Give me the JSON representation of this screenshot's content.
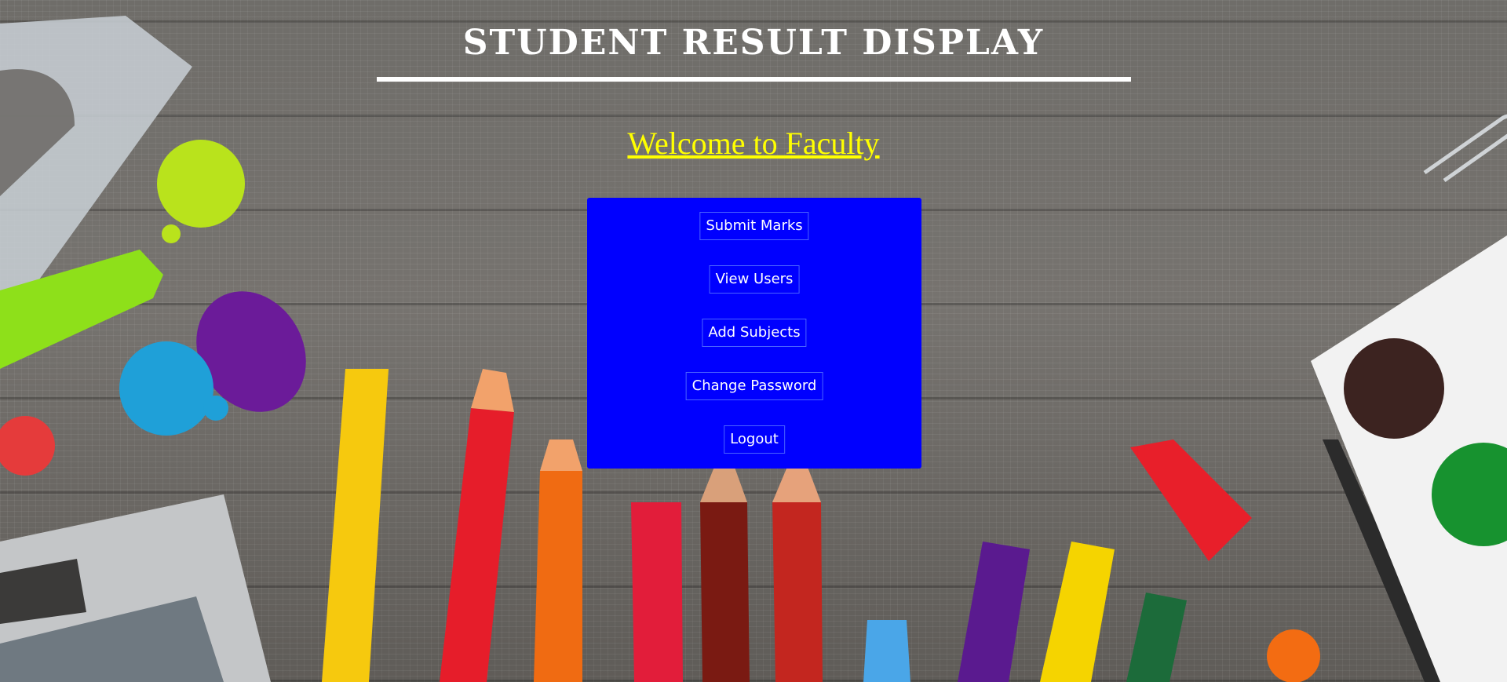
{
  "page": {
    "title": "STUDENT RESULT DISPLAY",
    "welcome": "Welcome to Faculty"
  },
  "menu": {
    "buttons": [
      "Submit Marks",
      "View Users",
      "Add Subjects",
      "Change Password",
      "Logout"
    ]
  },
  "colors": {
    "panel": "#0000ff",
    "welcome_text": "#ffff00",
    "title_text": "#ffffff"
  }
}
